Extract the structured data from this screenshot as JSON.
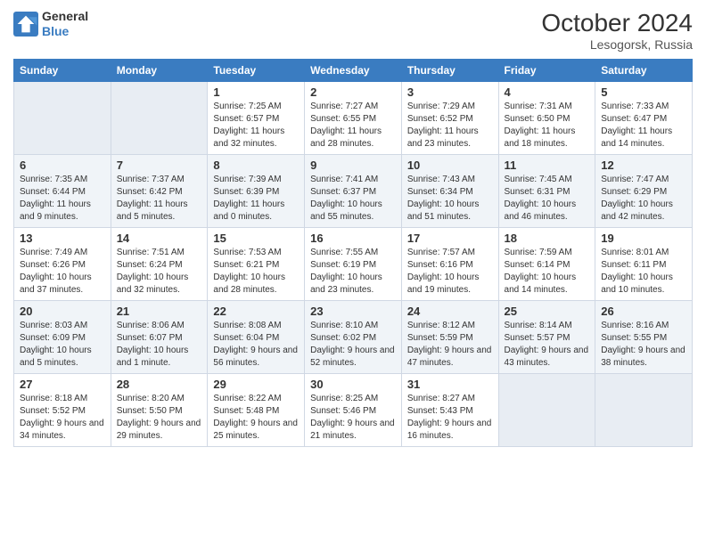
{
  "header": {
    "logo_general": "General",
    "logo_blue": "Blue",
    "month_title": "October 2024",
    "location": "Lesogorsk, Russia"
  },
  "days_of_week": [
    "Sunday",
    "Monday",
    "Tuesday",
    "Wednesday",
    "Thursday",
    "Friday",
    "Saturday"
  ],
  "weeks": [
    [
      {
        "day": null
      },
      {
        "day": null
      },
      {
        "day": "1",
        "sunrise": "Sunrise: 7:25 AM",
        "sunset": "Sunset: 6:57 PM",
        "daylight": "Daylight: 11 hours and 32 minutes."
      },
      {
        "day": "2",
        "sunrise": "Sunrise: 7:27 AM",
        "sunset": "Sunset: 6:55 PM",
        "daylight": "Daylight: 11 hours and 28 minutes."
      },
      {
        "day": "3",
        "sunrise": "Sunrise: 7:29 AM",
        "sunset": "Sunset: 6:52 PM",
        "daylight": "Daylight: 11 hours and 23 minutes."
      },
      {
        "day": "4",
        "sunrise": "Sunrise: 7:31 AM",
        "sunset": "Sunset: 6:50 PM",
        "daylight": "Daylight: 11 hours and 18 minutes."
      },
      {
        "day": "5",
        "sunrise": "Sunrise: 7:33 AM",
        "sunset": "Sunset: 6:47 PM",
        "daylight": "Daylight: 11 hours and 14 minutes."
      }
    ],
    [
      {
        "day": "6",
        "sunrise": "Sunrise: 7:35 AM",
        "sunset": "Sunset: 6:44 PM",
        "daylight": "Daylight: 11 hours and 9 minutes."
      },
      {
        "day": "7",
        "sunrise": "Sunrise: 7:37 AM",
        "sunset": "Sunset: 6:42 PM",
        "daylight": "Daylight: 11 hours and 5 minutes."
      },
      {
        "day": "8",
        "sunrise": "Sunrise: 7:39 AM",
        "sunset": "Sunset: 6:39 PM",
        "daylight": "Daylight: 11 hours and 0 minutes."
      },
      {
        "day": "9",
        "sunrise": "Sunrise: 7:41 AM",
        "sunset": "Sunset: 6:37 PM",
        "daylight": "Daylight: 10 hours and 55 minutes."
      },
      {
        "day": "10",
        "sunrise": "Sunrise: 7:43 AM",
        "sunset": "Sunset: 6:34 PM",
        "daylight": "Daylight: 10 hours and 51 minutes."
      },
      {
        "day": "11",
        "sunrise": "Sunrise: 7:45 AM",
        "sunset": "Sunset: 6:31 PM",
        "daylight": "Daylight: 10 hours and 46 minutes."
      },
      {
        "day": "12",
        "sunrise": "Sunrise: 7:47 AM",
        "sunset": "Sunset: 6:29 PM",
        "daylight": "Daylight: 10 hours and 42 minutes."
      }
    ],
    [
      {
        "day": "13",
        "sunrise": "Sunrise: 7:49 AM",
        "sunset": "Sunset: 6:26 PM",
        "daylight": "Daylight: 10 hours and 37 minutes."
      },
      {
        "day": "14",
        "sunrise": "Sunrise: 7:51 AM",
        "sunset": "Sunset: 6:24 PM",
        "daylight": "Daylight: 10 hours and 32 minutes."
      },
      {
        "day": "15",
        "sunrise": "Sunrise: 7:53 AM",
        "sunset": "Sunset: 6:21 PM",
        "daylight": "Daylight: 10 hours and 28 minutes."
      },
      {
        "day": "16",
        "sunrise": "Sunrise: 7:55 AM",
        "sunset": "Sunset: 6:19 PM",
        "daylight": "Daylight: 10 hours and 23 minutes."
      },
      {
        "day": "17",
        "sunrise": "Sunrise: 7:57 AM",
        "sunset": "Sunset: 6:16 PM",
        "daylight": "Daylight: 10 hours and 19 minutes."
      },
      {
        "day": "18",
        "sunrise": "Sunrise: 7:59 AM",
        "sunset": "Sunset: 6:14 PM",
        "daylight": "Daylight: 10 hours and 14 minutes."
      },
      {
        "day": "19",
        "sunrise": "Sunrise: 8:01 AM",
        "sunset": "Sunset: 6:11 PM",
        "daylight": "Daylight: 10 hours and 10 minutes."
      }
    ],
    [
      {
        "day": "20",
        "sunrise": "Sunrise: 8:03 AM",
        "sunset": "Sunset: 6:09 PM",
        "daylight": "Daylight: 10 hours and 5 minutes."
      },
      {
        "day": "21",
        "sunrise": "Sunrise: 8:06 AM",
        "sunset": "Sunset: 6:07 PM",
        "daylight": "Daylight: 10 hours and 1 minute."
      },
      {
        "day": "22",
        "sunrise": "Sunrise: 8:08 AM",
        "sunset": "Sunset: 6:04 PM",
        "daylight": "Daylight: 9 hours and 56 minutes."
      },
      {
        "day": "23",
        "sunrise": "Sunrise: 8:10 AM",
        "sunset": "Sunset: 6:02 PM",
        "daylight": "Daylight: 9 hours and 52 minutes."
      },
      {
        "day": "24",
        "sunrise": "Sunrise: 8:12 AM",
        "sunset": "Sunset: 5:59 PM",
        "daylight": "Daylight: 9 hours and 47 minutes."
      },
      {
        "day": "25",
        "sunrise": "Sunrise: 8:14 AM",
        "sunset": "Sunset: 5:57 PM",
        "daylight": "Daylight: 9 hours and 43 minutes."
      },
      {
        "day": "26",
        "sunrise": "Sunrise: 8:16 AM",
        "sunset": "Sunset: 5:55 PM",
        "daylight": "Daylight: 9 hours and 38 minutes."
      }
    ],
    [
      {
        "day": "27",
        "sunrise": "Sunrise: 8:18 AM",
        "sunset": "Sunset: 5:52 PM",
        "daylight": "Daylight: 9 hours and 34 minutes."
      },
      {
        "day": "28",
        "sunrise": "Sunrise: 8:20 AM",
        "sunset": "Sunset: 5:50 PM",
        "daylight": "Daylight: 9 hours and 29 minutes."
      },
      {
        "day": "29",
        "sunrise": "Sunrise: 8:22 AM",
        "sunset": "Sunset: 5:48 PM",
        "daylight": "Daylight: 9 hours and 25 minutes."
      },
      {
        "day": "30",
        "sunrise": "Sunrise: 8:25 AM",
        "sunset": "Sunset: 5:46 PM",
        "daylight": "Daylight: 9 hours and 21 minutes."
      },
      {
        "day": "31",
        "sunrise": "Sunrise: 8:27 AM",
        "sunset": "Sunset: 5:43 PM",
        "daylight": "Daylight: 9 hours and 16 minutes."
      },
      {
        "day": null
      },
      {
        "day": null
      }
    ]
  ]
}
